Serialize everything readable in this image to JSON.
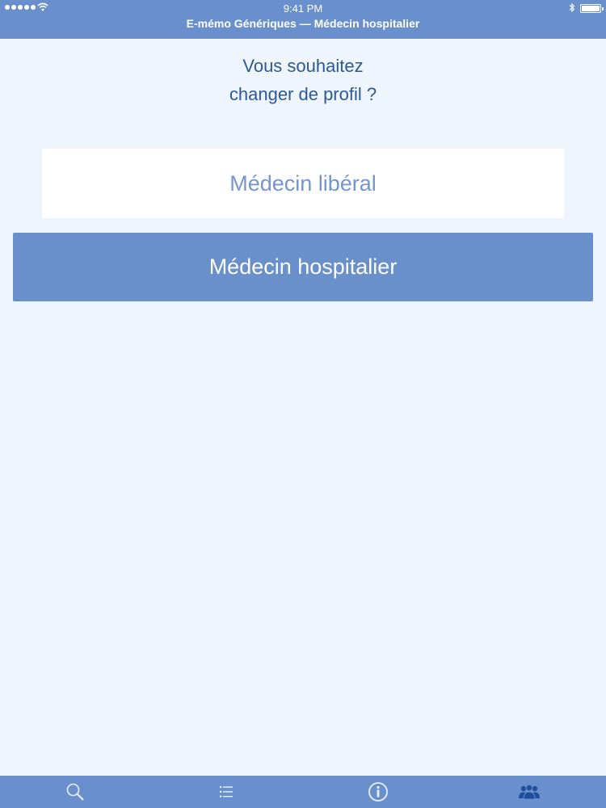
{
  "status_bar": {
    "time": "9:41 PM"
  },
  "header": {
    "title": "E-mémo Génériques — Médecin hospitalier"
  },
  "main": {
    "question_line1": "Vous souhaitez",
    "question_line2": "changer de profil ?",
    "options": [
      {
        "label": "Médecin libéral",
        "selected": false
      },
      {
        "label": "Médecin hospitalier",
        "selected": true
      }
    ]
  },
  "tabbar": {
    "tabs": [
      {
        "icon": "search-icon",
        "active": false
      },
      {
        "icon": "list-icon",
        "active": false
      },
      {
        "icon": "info-icon",
        "active": false
      },
      {
        "icon": "profile-group-icon",
        "active": true
      }
    ]
  },
  "colors": {
    "accent": "#6990cc",
    "background": "#eef5fd",
    "question_text": "#2d5893",
    "active_tab": "#1f4e9c"
  }
}
